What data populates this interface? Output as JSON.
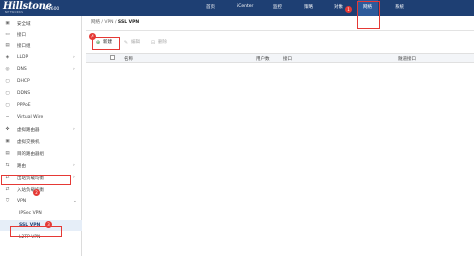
{
  "header": {
    "logo": "Hillstone",
    "logo_sub": "NETWORKS",
    "model": "E1600",
    "nav": [
      "首页",
      "iCenter",
      "监控",
      "策略",
      "对象",
      "网络",
      "系统"
    ],
    "active_nav": "网络"
  },
  "badges": {
    "b1": "1",
    "b2": "2",
    "b3": "3",
    "b4": "4"
  },
  "sidebar": {
    "items": [
      {
        "label": "安全域",
        "icon": "shield-icon",
        "arrow": ""
      },
      {
        "label": "接口",
        "icon": "interface-icon",
        "arrow": ""
      },
      {
        "label": "接口组",
        "icon": "interface-group-icon",
        "arrow": ""
      },
      {
        "label": "LLDP",
        "icon": "lldp-icon",
        "arrow": "›"
      },
      {
        "label": "DNS",
        "icon": "dns-icon",
        "arrow": "›"
      },
      {
        "label": "DHCP",
        "icon": "dhcp-icon",
        "arrow": ""
      },
      {
        "label": "DDNS",
        "icon": "ddns-icon",
        "arrow": ""
      },
      {
        "label": "PPPoE",
        "icon": "pppoe-icon",
        "arrow": ""
      },
      {
        "label": "Virtual Wire",
        "icon": "virtual-wire-icon",
        "arrow": ""
      },
      {
        "label": "虚拟路由器",
        "icon": "virtual-router-icon",
        "arrow": "›"
      },
      {
        "label": "虚拟交换机",
        "icon": "virtual-switch-icon",
        "arrow": ""
      },
      {
        "label": "目的路由器组",
        "icon": "route-group-icon",
        "arrow": ""
      },
      {
        "label": "路由",
        "icon": "route-icon",
        "arrow": "›"
      },
      {
        "label": "出站负载均衡",
        "icon": "outbound-lb-icon",
        "arrow": "›"
      },
      {
        "label": "入站负载均衡",
        "icon": "inbound-lb-icon",
        "arrow": ""
      },
      {
        "label": "VPN",
        "icon": "vpn-icon",
        "arrow": "⌄"
      }
    ],
    "subitems": [
      "IPSec VPN",
      "SSL VPN",
      "L2TP VPN"
    ],
    "active_sub": "SSL VPN"
  },
  "breadcrumb": {
    "path": "网络 / VPN / ",
    "current": "SSL VPN"
  },
  "toolbar": {
    "new": "新建",
    "edit": "编辑",
    "delete": "删除"
  },
  "table": {
    "columns": [
      "名称",
      "用户数",
      "接口",
      "隧道接口"
    ]
  }
}
